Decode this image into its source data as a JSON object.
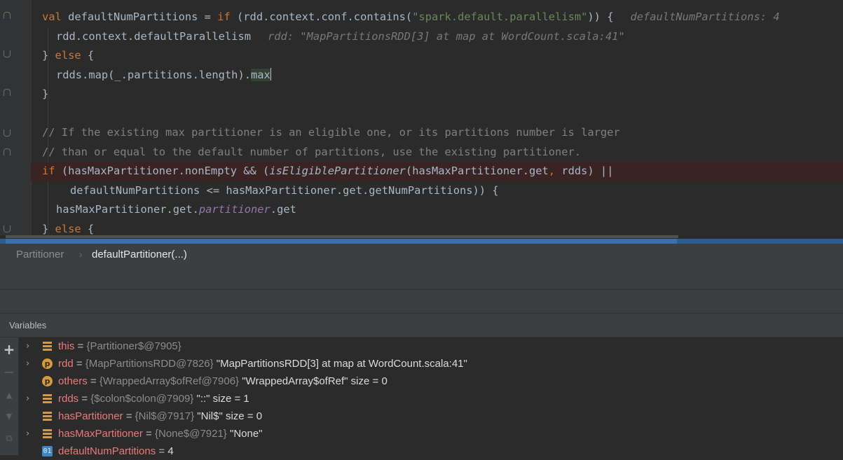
{
  "editor": {
    "lines": [
      {
        "kw1": "val",
        "name": " defaultNumPartitions = ",
        "kw2": "if",
        "pre": " (rdd.context.conf.contains(",
        "str": "\"spark.default.parallelism\"",
        "post": ")) {",
        "hint": "defaultNumPartitions: 4"
      },
      {
        "code": "rdd.context.defaultParallelism",
        "hint": "rdd: \"MapPartitionsRDD[3] at map at WordCount.scala:41\""
      },
      {
        "pre": "} ",
        "kw": "else",
        "post": " {"
      },
      {
        "pre": "rdds.map(_.partitions.length).",
        "caret": "max"
      },
      {
        "code": "}"
      },
      {
        "code": ""
      },
      {
        "comment": "// If the existing max partitioner is an eligible one, or its partitions number is larger"
      },
      {
        "comment": "// than or equal to the default number of partitions, use the existing partitioner."
      },
      {
        "kw": "if",
        "pre": " (hasMaxPartitioner.nonEmpty && (",
        "it": "isEligiblePartitioner",
        "mid": "(hasMaxPartitioner.get",
        "comma": ",",
        "post": " rdds) ||"
      },
      {
        "code": "defaultNumPartitions <= hasMaxPartitioner.get.getNumPartitions)) {"
      },
      {
        "pre": "hasMaxPartitioner.get.",
        "field": "partitioner",
        "post": ".get"
      },
      {
        "pre": "} ",
        "kw": "else",
        "post": " {"
      }
    ]
  },
  "breadcrumb": {
    "items": [
      "Partitioner",
      "defaultPartitioner(...)"
    ],
    "separator": "›"
  },
  "variables": {
    "title": "Variables",
    "toolbar": {
      "add": "+",
      "remove": "−",
      "up": "▲",
      "down": "▼",
      "copy": "⧉"
    },
    "rows": [
      {
        "expand": "›",
        "icon": "field",
        "name": "this",
        "eq": " = ",
        "ref": "{Partitioner$@7905}",
        "value": ""
      },
      {
        "expand": "›",
        "icon": "param",
        "icon_label": "p",
        "name": "rdd",
        "eq": " = ",
        "ref": "{MapPartitionsRDD@7826}",
        "value": " \"MapPartitionsRDD[3] at map at WordCount.scala:41\""
      },
      {
        "expand": "",
        "icon": "param",
        "icon_label": "p",
        "name": "others",
        "eq": " = ",
        "ref": "{WrappedArray$ofRef@7906}",
        "value": " \"WrappedArray$ofRef\" size = 0"
      },
      {
        "expand": "›",
        "icon": "field",
        "name": "rdds",
        "eq": " = ",
        "ref": "{$colon$colon@7909}",
        "value": " \"::\" size = 1"
      },
      {
        "expand": "",
        "icon": "field",
        "name": "hasPartitioner",
        "eq": " = ",
        "ref": "{Nil$@7917}",
        "value": " \"Nil$\" size = 0"
      },
      {
        "expand": "›",
        "icon": "field",
        "name": "hasMaxPartitioner",
        "eq": " = ",
        "ref": "{None$@7921}",
        "value": " \"None\""
      },
      {
        "expand": "",
        "icon": "prim",
        "icon_label": "01",
        "name": "defaultNumPartitions",
        "eq": " = ",
        "ref": "",
        "value": "4"
      }
    ]
  },
  "colors": {
    "editor_bg": "#2b2b2b",
    "keyword": "#cc7832",
    "string": "#6a8759",
    "comment": "#808080",
    "variable_name": "#e97a7c",
    "breakpoint_line": "#3a2323",
    "accent_bar": "#3b6fae"
  }
}
